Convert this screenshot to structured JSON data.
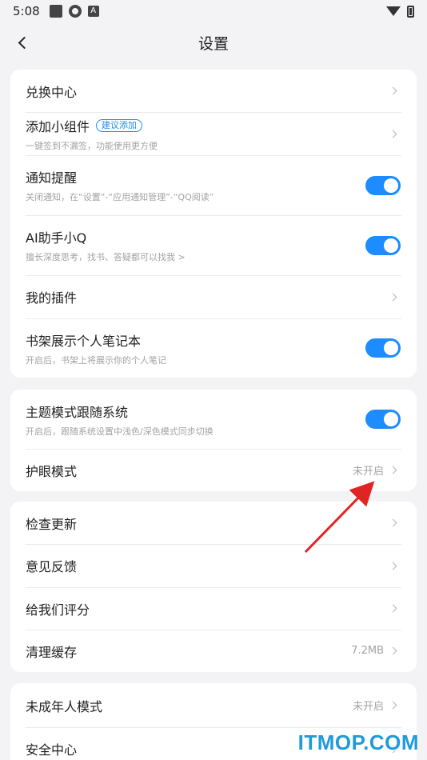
{
  "status_bar": {
    "time": "5:08",
    "icons": [
      "app-square-icon",
      "aperture-icon",
      "a-icon",
      "wifi-icon",
      "battery-charging-icon"
    ]
  },
  "header": {
    "title": "设置",
    "back_icon": "chevron-left-icon"
  },
  "group1": {
    "exchange": {
      "title": "兑换中心"
    },
    "widget": {
      "title": "添加小组件",
      "badge": "建议添加",
      "subtitle": "一键签到不漏签，功能使用更方便"
    },
    "notify": {
      "title": "通知提醒",
      "subtitle": "关闭通知，在“设置”-“应用通知管理”-“QQ阅读”",
      "on": true
    },
    "ai": {
      "title": "AI助手小Q",
      "subtitle": "擅长深度思考，找书、答疑都可以找我 >",
      "on": true
    },
    "plugins": {
      "title": "我的插件"
    },
    "notebook": {
      "title": "书架展示个人笔记本",
      "subtitle": "开启后，书架上将展示你的个人笔记",
      "on": true
    }
  },
  "group2": {
    "theme": {
      "title": "主题模式跟随系统",
      "subtitle": "开启后，跟随系统设置中浅色/深色模式同步切换",
      "on": true
    },
    "eye": {
      "title": "护眼模式",
      "value": "未开启"
    }
  },
  "group3": {
    "update": {
      "title": "检查更新"
    },
    "feedback": {
      "title": "意见反馈"
    },
    "rate": {
      "title": "给我们评分"
    },
    "cache": {
      "title": "清理缓存",
      "value": "7.2MB"
    }
  },
  "group4": {
    "minor": {
      "title": "未成年人模式",
      "value": "未开启"
    },
    "security": {
      "title": "安全中心"
    }
  },
  "watermark": "ITMOP.COM",
  "colors": {
    "accent": "#1c8cff",
    "arrow": "#e02424",
    "background": "#f3f3f5"
  }
}
